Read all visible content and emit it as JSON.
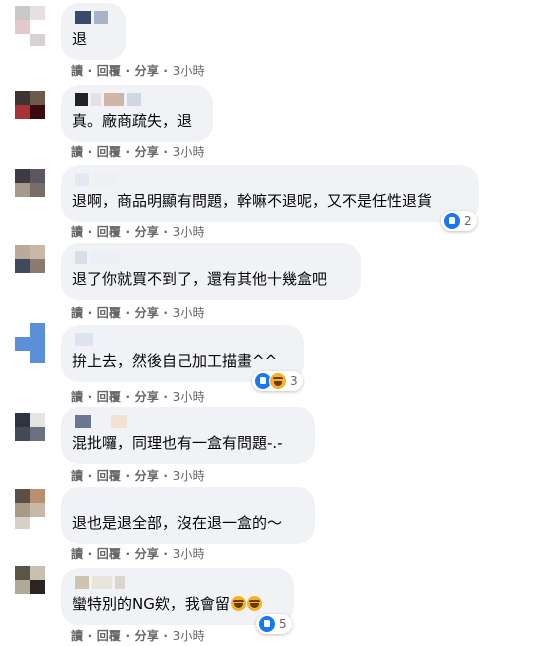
{
  "actions": {
    "read": "讀",
    "reply": "回覆",
    "share": "分享",
    "time": "3小時",
    "sep": " · "
  },
  "colors": {
    "bubble": "#f0f2f5",
    "meta": "#65676b",
    "like": "#1877f2",
    "haha": "#f7b125"
  },
  "comments": [
    {
      "text": "退"
    },
    {
      "text": "真。廠商疏失，退"
    },
    {
      "text": "退啊，商品明顯有問題，幹嘛不退呢，又不是任性退貨",
      "reaction_count": "2",
      "reactions": [
        "like-icon"
      ]
    },
    {
      "text": "退了你就買不到了，還有其他十幾盒吧"
    },
    {
      "text": "拚上去，然後自己加工描畫^^",
      "reaction_count": "3",
      "reactions": [
        "like-icon",
        "haha-icon"
      ]
    },
    {
      "text": "混批囉，同理也有一盒有問題-.-"
    },
    {
      "text": "退也是退全部，沒在退一盒的～"
    },
    {
      "text": "蠻特別的NG欸，我會留",
      "emoji": [
        "haha-emoji",
        "haha-emoji"
      ],
      "reaction_count": "5",
      "reactions": [
        "like-icon"
      ]
    }
  ]
}
